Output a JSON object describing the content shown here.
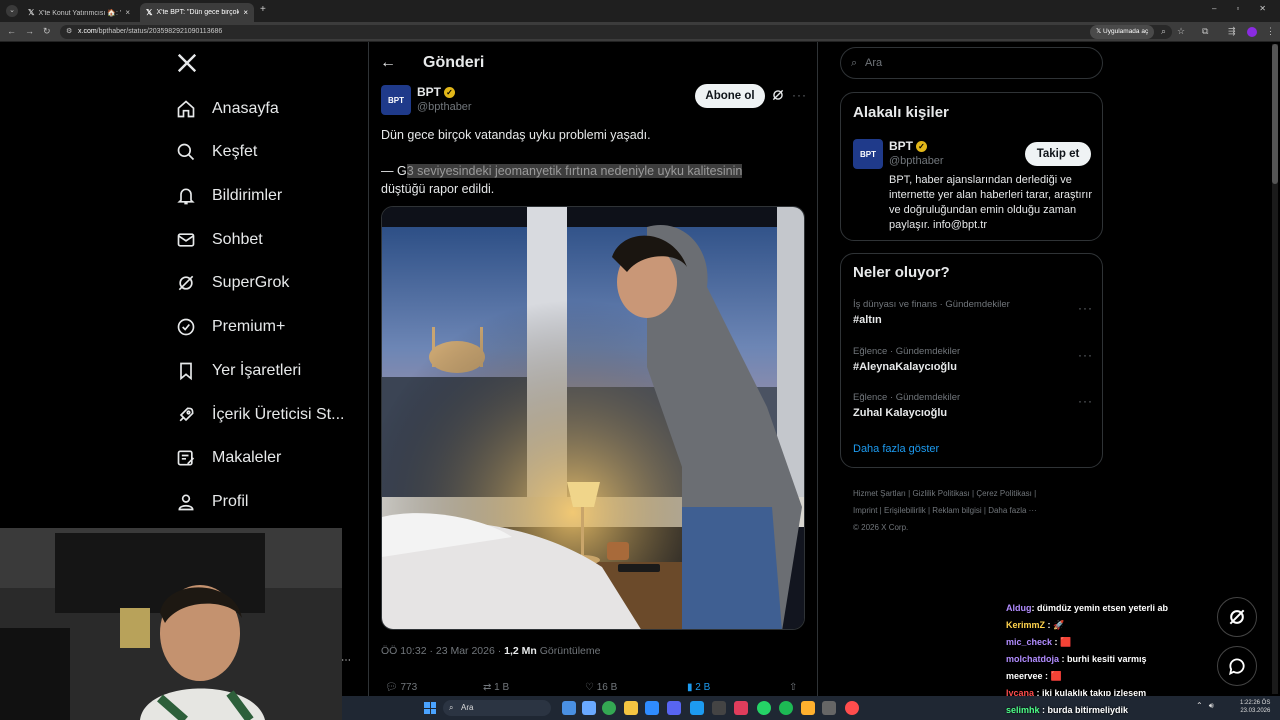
{
  "browser": {
    "tabs": [
      {
        "label": "X'te Konut Yatırımcısı 🏠: \"Hem",
        "active": false
      },
      {
        "label": "X'te BPT: \"Dün gece birçok vat",
        "active": true
      }
    ],
    "url_host": "x.com",
    "url_path": "/bpthaber/status/2035982921090113686",
    "app_chip": "Uygulamada aç"
  },
  "sidebar": {
    "items": [
      {
        "label": "Anasayfa",
        "icon": "home-icon"
      },
      {
        "label": "Keşfet",
        "icon": "search-icon"
      },
      {
        "label": "Bildirimler",
        "icon": "bell-icon"
      },
      {
        "label": "Sohbet",
        "icon": "mail-icon"
      },
      {
        "label": "SuperGrok",
        "icon": "grok-icon"
      },
      {
        "label": "Premium+",
        "icon": "verified-icon"
      },
      {
        "label": "Yer İşaretleri",
        "icon": "bookmark-icon"
      },
      {
        "label": "İçerik Üreticisi St...",
        "icon": "rocket-icon"
      },
      {
        "label": "Makaleler",
        "icon": "article-icon"
      },
      {
        "label": "Profil",
        "icon": "person-icon"
      }
    ]
  },
  "post": {
    "header_title": "Gönderi",
    "author_name": "BPT",
    "author_handle": "@bpthaber",
    "avatar_text": "BPT",
    "subscribe_label": "Abone ol",
    "text_line1": "Dün gece birçok vatandaş uyku problemi yaşadı.",
    "text_line2_prefix": "— G",
    "text_line2_highlight": "3 seviyesindeki jeomanyetik fırtına nedeniyle uyku kalitesinin",
    "text_line3": "düştüğü rapor edildi.",
    "time": "ÖÖ 10:32 · 23 Mar 2026 · ",
    "views_count": "1,2 Mn",
    "views_label": " Görüntüleme",
    "actions": {
      "replies": "773",
      "reposts": "1 B",
      "likes": "16 B",
      "bookmarks": "2 B"
    }
  },
  "right": {
    "search_placeholder": "Ara",
    "related_title": "Alakalı kişiler",
    "related": {
      "name": "BPT",
      "handle": "@bpthaber",
      "follow_label": "Takip et",
      "bio": "BPT, haber ajanslarından derlediği ve internette yer alan haberleri tarar, araştırır ve doğruluğundan emin olduğu zaman paylaşır. info@bpt.tr"
    },
    "trends_title": "Neler oluyor?",
    "trends": [
      {
        "context": "İş dünyası ve finans · Gündemdekiler",
        "topic": "#altın"
      },
      {
        "context": "Eğlence · Gündemdekiler",
        "topic": "#AleynaKalaycıoğlu"
      },
      {
        "context": "Eğlence · Gündemdekiler",
        "topic": "Zuhal Kalaycıoğlu"
      }
    ],
    "show_more": "Daha fazla göster",
    "footer_links": [
      "Hizmet Şartları",
      "Gizlilik Politikası",
      "Çerez Politikası",
      "Imprint",
      "Erişilebilirlik",
      "Reklam bilgisi",
      "Daha fazla ···"
    ],
    "copyright": "© 2026 X Corp."
  },
  "chat": [
    {
      "user": "Aldug",
      "msg": ": dümdüz yemin etsen yeterli ab",
      "color": "#b18cff"
    },
    {
      "user": "KerimmZ",
      "msg": " : 🚀",
      "color": "#ffd34d"
    },
    {
      "user": "mic_check",
      "msg": " : 🟥",
      "color": "#b18cff"
    },
    {
      "user": "molchatdoja",
      "msg": " : burhi kesiti varmış",
      "color": "#b18cff"
    },
    {
      "user": "meervee",
      "msg": " : 🟥",
      "color": "#ffffff"
    },
    {
      "user": "lycana",
      "msg": " : iki kulaklık takıp izlesem",
      "color": "#ff4d4d"
    },
    {
      "user": "selimhk",
      "msg": " : burda bitirmeliydik",
      "color": "#4dff88"
    }
  ],
  "taskbar": {
    "search_label": "Ara",
    "time": "1:22:26 ÖS",
    "date": "23.03.2026"
  },
  "colors": {
    "accent": "#1d9bf0",
    "verified": "#e2b719",
    "background": "#000000"
  }
}
